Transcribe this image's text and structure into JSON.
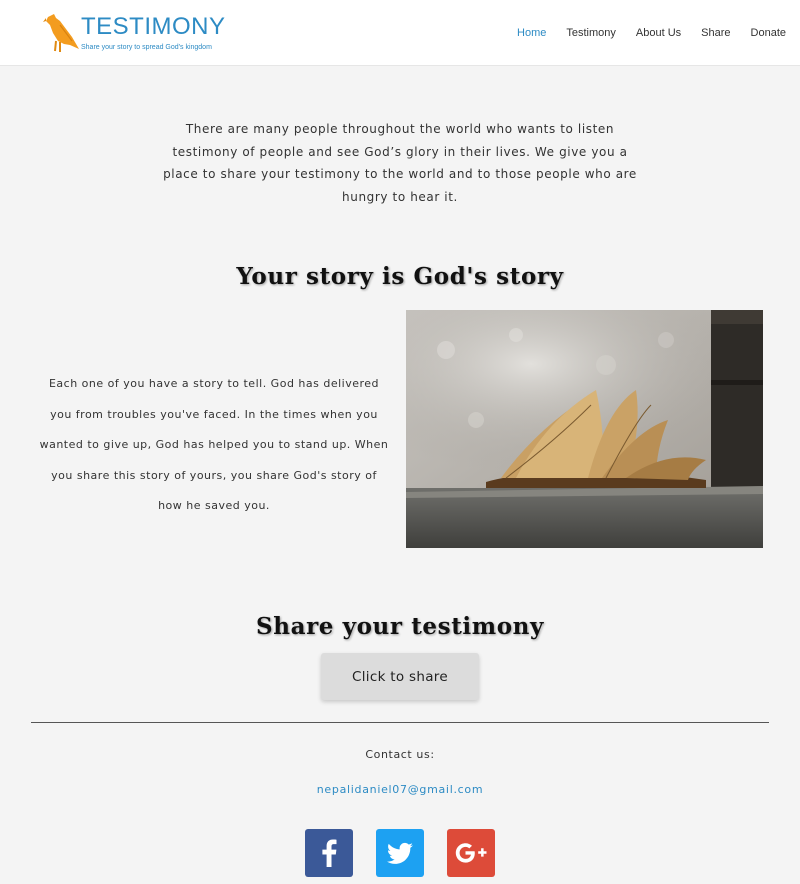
{
  "header": {
    "logo_title": "TESTIMONY",
    "logo_tagline": "Share your story to spread God's kingdom",
    "nav": [
      {
        "label": "Home",
        "active": true
      },
      {
        "label": "Testimony",
        "active": false
      },
      {
        "label": "About Us",
        "active": false
      },
      {
        "label": "Share",
        "active": false
      },
      {
        "label": "Donate",
        "active": false
      }
    ]
  },
  "intro": {
    "text": "There are many people throughout the world who wants to listen testimony of people and see God’s glory in their lives. We give you a place to share your testimony to the world and to those people who are hungry to hear it."
  },
  "story": {
    "title": "Your story is God's story",
    "text": "Each one of you have a story to tell. God has delivered you from troubles you've faced. In the times when you wanted to give up, God has helped you to stand up. When you share this story of yours, you share God's story of how he saved you.",
    "image_icon": "open-book-on-stone-image"
  },
  "share": {
    "title": "Share your testimony",
    "button_label": "Click to share"
  },
  "footer": {
    "contact_label": "Contact us:",
    "email": "nepalidaniel07@gmail.com",
    "social": [
      {
        "name": "facebook-icon",
        "color": "#3b5998"
      },
      {
        "name": "twitter-icon",
        "color": "#1da1f2"
      },
      {
        "name": "google-plus-icon",
        "color": "#dd4b39"
      }
    ]
  },
  "colors": {
    "accent": "#2d8bc4",
    "logo_bird": "#f39c1f",
    "background": "#f4f4f4"
  }
}
